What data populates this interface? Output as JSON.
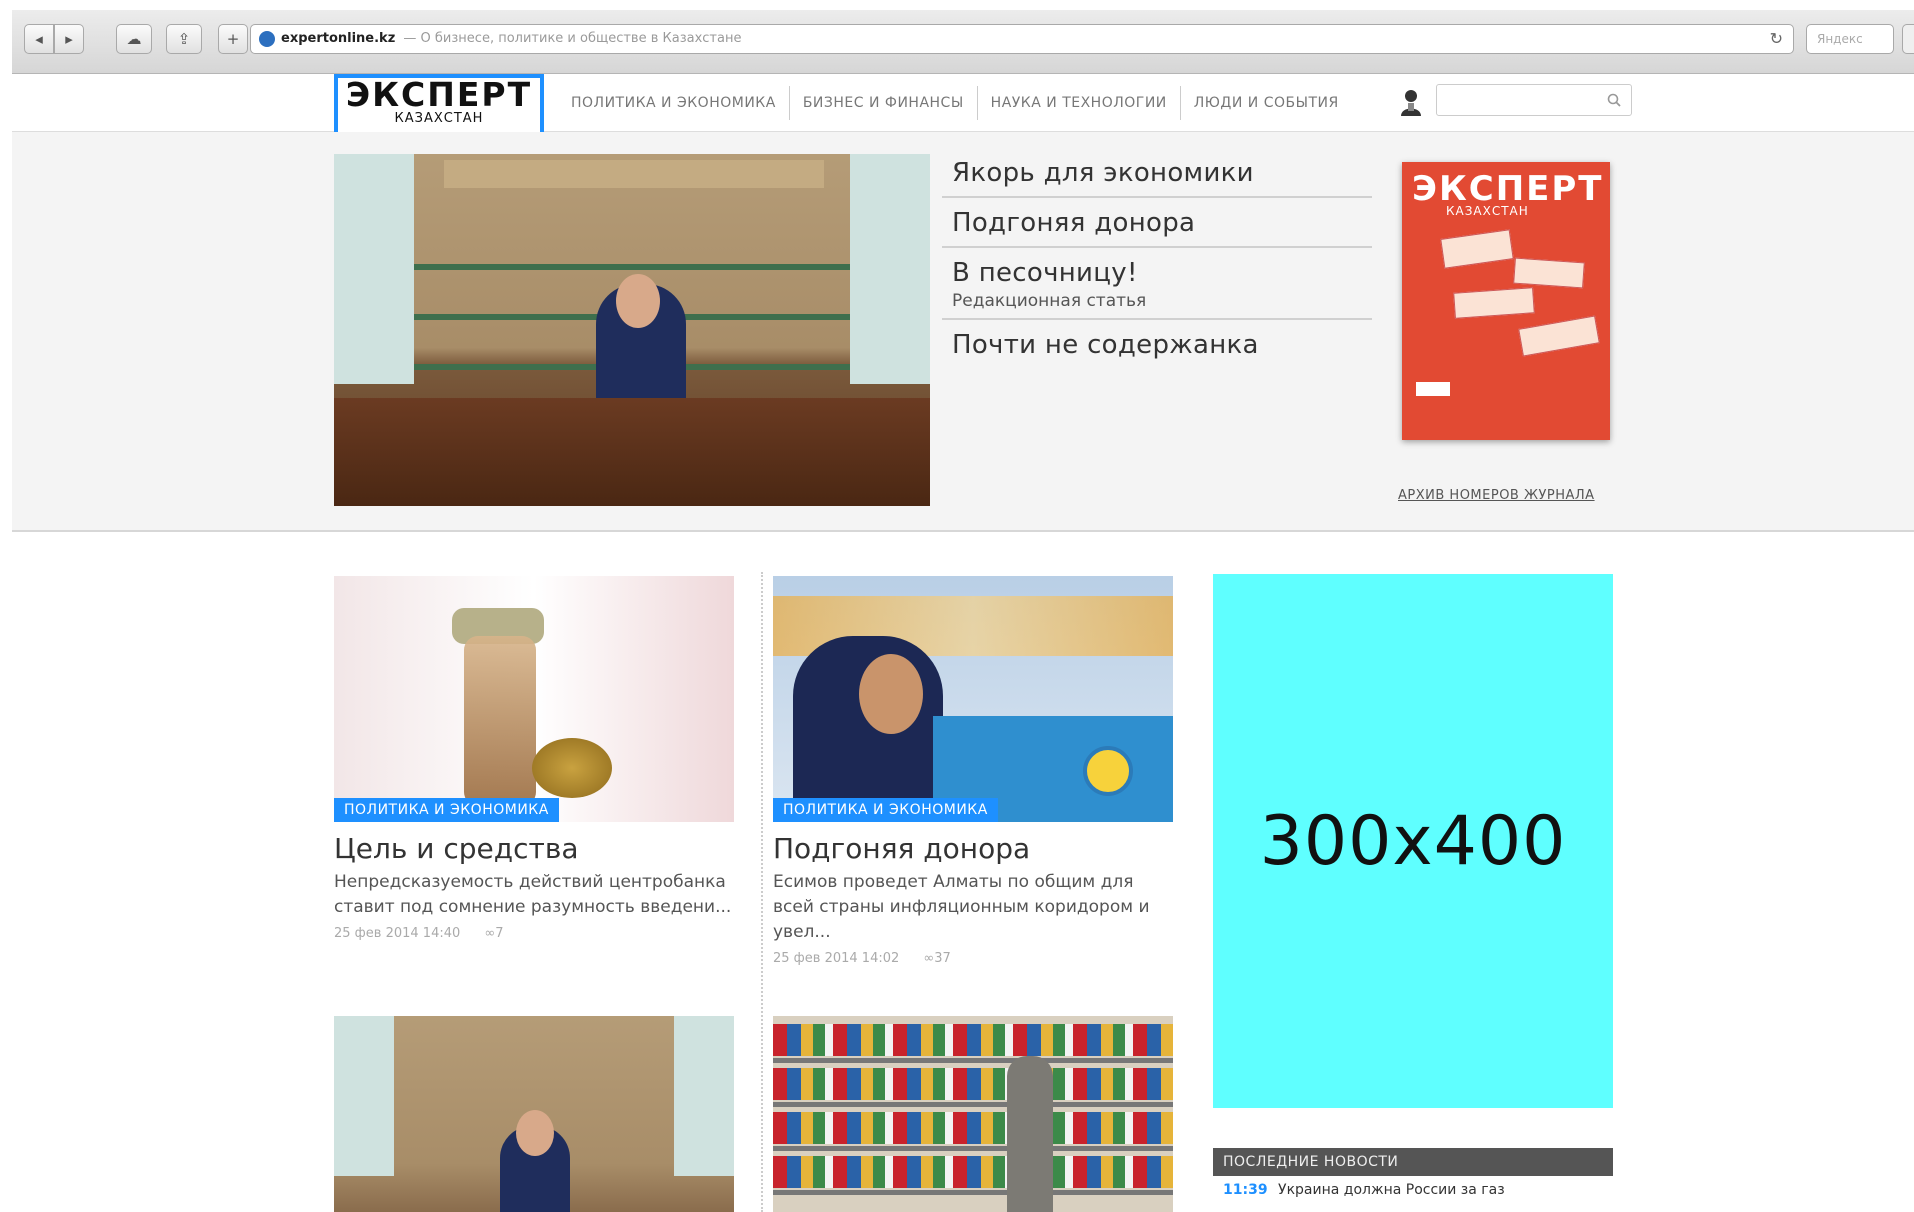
{
  "browser": {
    "nav_back": "◂",
    "nav_forward": "▸",
    "cloud": "☁",
    "share": "⇪",
    "add": "+",
    "url_domain": "expertonline.kz",
    "url_description": "— О бизнесе, политике и обществе в Казахстане",
    "reload": "↻",
    "search_placeholder": "Яндекс"
  },
  "site": {
    "logo_main": "ЭКСПЕРТ",
    "logo_sub": "КАЗАХСТАН",
    "nav": [
      "ПОЛИТИКА И ЭКОНОМИКА",
      "БИЗНЕС И ФИНАНСЫ",
      "НАУКА И ТЕХНОЛОГИИ",
      "ЛЮДИ И СОБЫТИЯ"
    ]
  },
  "hero": {
    "items": [
      {
        "title": "Якорь для экономики"
      },
      {
        "title": "Подгоняя донора"
      },
      {
        "title": "В песочницу!",
        "subtitle": "Редакционная статья"
      },
      {
        "title": "Почти не содержанка"
      }
    ],
    "cover_title": "ЭКСПЕРТ",
    "cover_sub": "КАЗАХСТАН",
    "archive_link": "АРХИВ НОМЕРОВ ЖУРНАЛА"
  },
  "articles": [
    {
      "tag": "ПОЛИТИКА И ЭКОНОМИКА",
      "title": "Цель и средства",
      "lead": "Непредсказуемость действий центробанка ставит под сомнение разумность введени...",
      "date": "25 фев 2014 14:40",
      "comments": "7"
    },
    {
      "tag": "ПОЛИТИКА И ЭКОНОМИКА",
      "title": "Подгоняя донора",
      "lead": "Есимов проведет Алматы по общим для всей страны инфляционным коридором и увел...",
      "date": "25 фев 2014 14:02",
      "comments": "37"
    }
  ],
  "ad": {
    "label": "300x400"
  },
  "news": {
    "header": "ПОСЛЕДНИЕ НОВОСТИ",
    "items": [
      {
        "time": "11:39",
        "text": "Украина должна России за газ"
      }
    ]
  }
}
